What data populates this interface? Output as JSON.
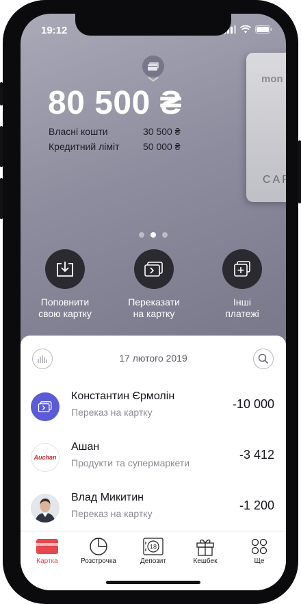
{
  "status": {
    "time": "19:12"
  },
  "balance": {
    "amount": "80 500 ₴",
    "own_label": "Власні кошти",
    "own_value": "30 500 ₴",
    "credit_label": "Кредитний ліміт",
    "credit_value": "50 000 ₴"
  },
  "card": {
    "brand_partial": "mon",
    "type_partial": "CAR"
  },
  "pager": {
    "count": 3,
    "active": 2
  },
  "actions": [
    {
      "label_line1": "Поповнити",
      "label_line2": "свою картку",
      "icon": "download-icon"
    },
    {
      "label_line1": "Переказати",
      "label_line2": "на картку",
      "icon": "card-transfer-icon"
    },
    {
      "label_line1": "Інші",
      "label_line2": "платежі",
      "icon": "other-payments-icon"
    }
  ],
  "feed": {
    "date": "17 лютого 2019",
    "transactions": [
      {
        "name": "Константин Єрмолін",
        "category": "Переказ на картку",
        "amount": "-10 000"
      },
      {
        "name": "Ашан",
        "category": "Продукти та супермаркети",
        "amount": "-3 412",
        "logo_text": "Auchan"
      },
      {
        "name": "Влад Микитин",
        "category": "Переказ на картку",
        "amount": "-1 200"
      }
    ]
  },
  "tabs": [
    {
      "label": "Картка",
      "icon": "card-icon",
      "active": true
    },
    {
      "label": "Розстрочка",
      "icon": "pie-chart-icon",
      "active": false
    },
    {
      "label": "Депозит",
      "icon": "deposit-icon",
      "active": false,
      "badge": "18"
    },
    {
      "label": "Кешбек",
      "icon": "gift-icon",
      "active": false
    },
    {
      "label": "Ще",
      "icon": "more-icon",
      "active": false
    }
  ],
  "colors": {
    "accent": "#e5484d",
    "dark_button": "#2a2a30",
    "transfer_avatar": "#5b5bd6"
  }
}
